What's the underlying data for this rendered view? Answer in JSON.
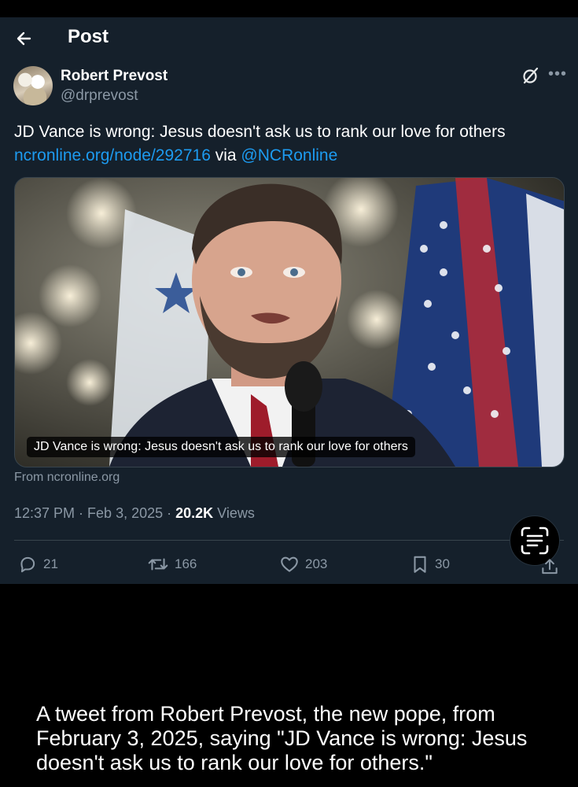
{
  "header": {
    "title": "Post",
    "back_icon": "arrow-left-icon"
  },
  "author": {
    "display_name": "Robert Prevost",
    "handle": "@drprevost"
  },
  "tweet": {
    "text": "JD Vance is wrong: Jesus doesn't ask us to rank our love for others",
    "link_text": "ncronline.org/node/292716",
    "via_text": " via ",
    "mention": "@NCRonline"
  },
  "card": {
    "caption": "JD Vance is wrong: Jesus doesn't ask us to rank our love for others",
    "from_domain": "From ncronline.org"
  },
  "meta": {
    "time": "12:37 PM",
    "sep1": " · ",
    "date": "Feb 3, 2025",
    "sep2": " · ",
    "views_count": "20.2K",
    "views_label": " Views"
  },
  "actions": {
    "replies": "21",
    "reposts": "166",
    "likes": "203",
    "bookmarks": "30"
  },
  "alt_text": "A tweet from Robert Prevost, the new pope, from February 3, 2025, saying \"JD Vance is wrong: Jesus doesn't ask us to rank our love for others.\"",
  "colors": {
    "background": "#15202b",
    "link": "#1d9bf0",
    "muted": "#8b98a5",
    "border": "#38444d"
  }
}
